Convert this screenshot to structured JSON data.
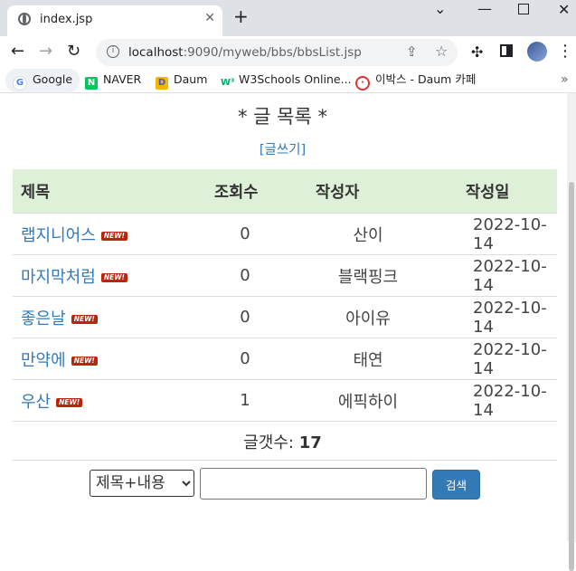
{
  "browser": {
    "tab_title": "index.jsp",
    "url_host": "localhost",
    "url_rest": ":9090/myweb/bbs/bbsList.jsp",
    "bookmarks": [
      {
        "label": "Google",
        "icon": "G"
      },
      {
        "label": "NAVER",
        "icon": "N"
      },
      {
        "label": "Daum",
        "icon": "D"
      },
      {
        "label": "W3Schools Online...",
        "icon": "W³"
      },
      {
        "label": "이박스 - Daum 카페",
        "icon": "·"
      }
    ]
  },
  "page": {
    "heading": "* 글 목록 *",
    "write_link": "[글쓰기]",
    "columns": [
      "제목",
      "조회수",
      "작성자",
      "작성일"
    ],
    "new_badge": "NEW!",
    "rows": [
      {
        "title": "랩지니어스",
        "views": "0",
        "author": "산이",
        "date": "2022-10-14"
      },
      {
        "title": "마지막처럼",
        "views": "0",
        "author": "블랙핑크",
        "date": "2022-10-14"
      },
      {
        "title": "좋은날",
        "views": "0",
        "author": "아이유",
        "date": "2022-10-14"
      },
      {
        "title": "만약에",
        "views": "0",
        "author": "태연",
        "date": "2022-10-14"
      },
      {
        "title": "우산",
        "views": "1",
        "author": "에픽하이",
        "date": "2022-10-14"
      }
    ],
    "count_label": "글갯수:",
    "count_value": "17",
    "search": {
      "selected_option": "제목+내용",
      "input_value": "",
      "button_label": "검색"
    }
  },
  "colors": {
    "link": "#337ab7",
    "header_bg": "#dff0d8",
    "badge": "#b8260f",
    "button": "#337ab7"
  }
}
